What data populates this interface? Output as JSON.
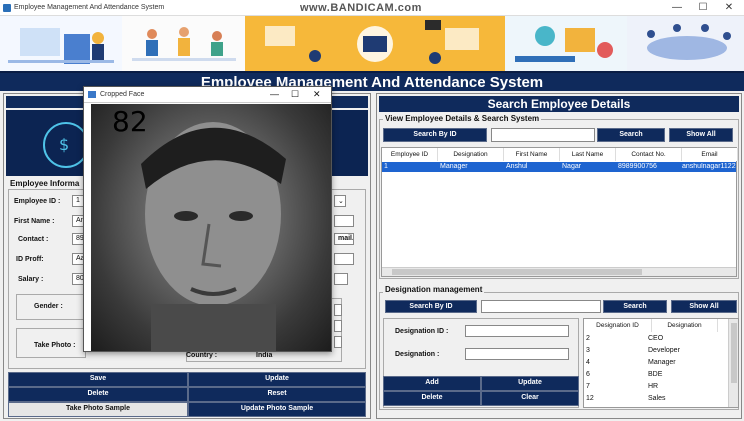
{
  "window": {
    "title": "Employee Management And Attendance System",
    "watermark": "www.BANDICAM.com",
    "minimize": "—",
    "maximize": "☐",
    "close": "✕"
  },
  "app": {
    "title": "Employee Management And Attendance System"
  },
  "left": {
    "section_label": "Employee Informa",
    "fields": {
      "employee_id_label": "Employee ID :",
      "employee_id": "1",
      "first_name_label": "First Name :",
      "first_name": "An",
      "contact_label": "Contact :",
      "contact": "898",
      "id_proof_label": "ID Proff:",
      "id_proof": "Aa",
      "salary_label": "Salary :",
      "salary": "800",
      "gender_label": "Gender :",
      "take_photo_label": "Take Photo :",
      "country_label": "Country :",
      "country": "India",
      "email_suffix": "mail."
    },
    "buttons": {
      "save": "Save",
      "update": "Update",
      "delete": "Delete",
      "reset": "Reset",
      "take_photo_sample": "Take Photo Sample",
      "update_photo_sample": "Update Photo Sample"
    }
  },
  "right": {
    "header": "Search Employee Details",
    "view_section": "View Employee Details & Search System",
    "search_by_id": "Search By ID",
    "search": "Search",
    "show_all": "Show All",
    "table": {
      "columns": [
        "Employee ID",
        "Designation",
        "First Name",
        "Last Name",
        "Contact No.",
        "Email"
      ],
      "rows": [
        [
          "1",
          "Manager",
          "Anshul",
          "Nagar",
          "8989900756",
          "anshulnagar11223"
        ]
      ]
    },
    "designation": {
      "section": "Designation management",
      "search_by_id": "Search By ID",
      "search": "Search",
      "show_all": "Show All",
      "id_label": "Designation ID :",
      "designation_label": "Designation :",
      "add": "Add",
      "update": "Update",
      "delete": "Delete",
      "clear": "Clear",
      "columns": [
        "Designation ID",
        "Designation"
      ],
      "rows": [
        [
          "2",
          "CEO"
        ],
        [
          "3",
          "Developer"
        ],
        [
          "4",
          "Manager"
        ],
        [
          "6",
          "BDE"
        ],
        [
          "7",
          "HR"
        ],
        [
          "12",
          "Sales"
        ]
      ]
    }
  },
  "cropped_face": {
    "title": "Cropped Face",
    "count": "82",
    "minimize": "—",
    "maximize": "☐",
    "close": "✕"
  },
  "colors": {
    "navy": "#0f2a5c",
    "selection": "#1e64d0"
  }
}
